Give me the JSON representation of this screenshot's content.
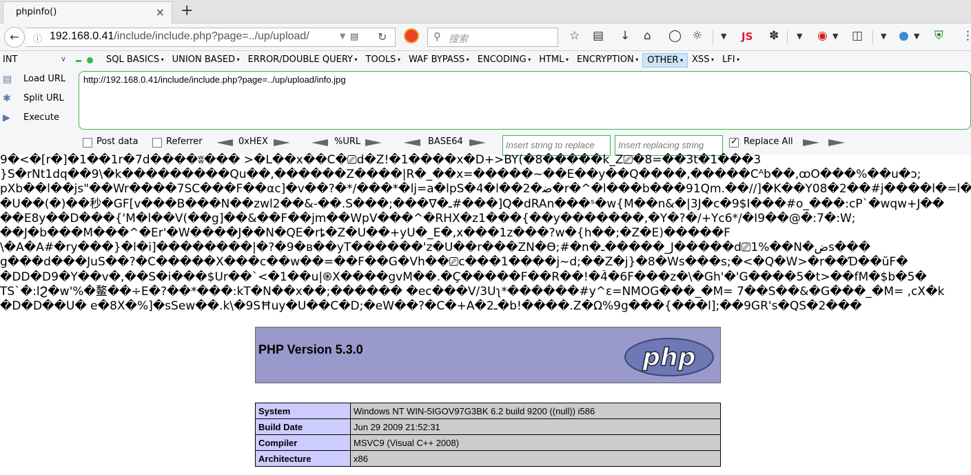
{
  "browser": {
    "tab_title": "phpinfo()",
    "tab_close": "×",
    "new_tab": "+",
    "url_host": "192.168.0.41",
    "url_path": "/include/include.php?page=../up/upload/",
    "search_placeholder": "搜索",
    "js_label": "JS"
  },
  "hackbar": {
    "select_value": "INT",
    "menus": [
      {
        "label": "SQL BASICS",
        "has_caret": true
      },
      {
        "label": "UNION BASED",
        "has_caret": true
      },
      {
        "label": "ERROR/DOUBLE QUERY",
        "has_caret": true
      },
      {
        "label": "TOOLS",
        "has_caret": true
      },
      {
        "label": "WAF BYPASS",
        "has_caret": true
      },
      {
        "label": "ENCODING",
        "has_caret": true
      },
      {
        "label": "HTML",
        "has_caret": true
      },
      {
        "label": "ENCRYPTION",
        "has_caret": true
      },
      {
        "label": "OTHER",
        "has_caret": true
      },
      {
        "label": "XSS",
        "has_caret": true
      },
      {
        "label": "LFI",
        "has_caret": true
      }
    ],
    "active_menu": "OTHER",
    "load_url": "Load URL",
    "split_url": "Split URL",
    "execute": "Execute",
    "url_value": "http://192.168.0.41/include/include.php?page=../up/upload/info.jpg",
    "post_data": "Post data",
    "referrer": "Referrer",
    "hex": "0xHEX",
    "urlenc": "%URL",
    "base64": "BASE64",
    "replace_placeholder": "Insert string to replace",
    "replacing_placeholder": "Insert replacing string",
    "replace_all": "Replace All",
    "replace_all_checked": true
  },
  "garbage_lines": [
    "9�<�[r�]�1��1r�7d����ʬ��� >�L��x��C�⎚d�Z!�1����x�D+>BY(�8�����k_Z⎚�8=��3t�1���3",
    "}S�rNt1dq��9\\�k���������Qu��,������Z����|R�_��x=�����~��E��y��Q����,�����Cᴬb��,ꝏO���%��u�ɔ;",
    "pXb��l��js\"��Wr����7SC���F��αc]�v��?�*/���*�lj=a�lpS�4�l��2�ﺿ�r�^�l���b���91Qm.��//]�K��Y08�2��#j����l�=l��",
    "�U��(�)��秒�GF[v���B���N��zwl2��&-��.S���;���∇�ـ#���]Q�dRAn���ˢ�w{M��n&�|3J�c�9$I���#o_���:cP`�wqw+J��",
    "��E8y��D���{'M�l��V(��g]��&��F��jm��WpV���^�RHX�z1���{��y�������,�Y�?�/+Yc6*/�I9��@�:7�:W;",
    "��J�b���M���^�Er'�W����J��N�QE�rȶ�Z�U��+yU�_E�,x���1z���?w�{h��;�Z�E)�����F",
    "\\�A�A#�ry���}�l�i]��������|�?�9�в��yT������'z�U��r���ZN�ϴ;#�n�ـ�����_J�����d⎚1%��N�ضs���",
    "g���d���JuS��?�C�����X���c��w��=��F��G�Vh��⎚c���1����j~d;��Z�j}�8�Ws���s;�<�Q�W>�r��Ɗ��ŭF�",
    "�DD�D9�Y��v�,��S�i���$Ur��`<�1��u|֍X����gvM��.�Ç�����F��R��!�4̆�6F���z�\\�Gh'�'G����5�t>��fM�$b�5�",
    "TS`�:lϨ�w'%�鳌��÷E�?��*���:kT�N��x��;������ �ec���V/3Uʅ*������#y^ɛ=NMOG���_�M= 7��S��&�G���_�M= ,cX�k",
    "�D�D��U� e�8X�%]�sSew��.k\\�9SĦuy�U��C�D;�eW��?�C�+A�2ـ�b!����.Z�Ω%9g���{���l];��9GR's�QS�2���"
  ],
  "php": {
    "version_title": "PHP Version 5.3.0",
    "logo_text": "php",
    "rows": [
      {
        "key": "System",
        "value": "Windows NT WIN-5IGOV97G3BK 6.2 build 9200 ((null)) i586"
      },
      {
        "key": "Build Date",
        "value": "Jun 29 2009 21:52:31"
      },
      {
        "key": "Compiler",
        "value": "MSVC9 (Visual C++ 2008)"
      },
      {
        "key": "Architecture",
        "value": "x86"
      }
    ]
  },
  "icons": [
    "back-arrow-icon",
    "info-icon",
    "page-icon",
    "reload-icon",
    "blocker-icon",
    "search-icon",
    "star-icon",
    "reading-list-icon",
    "download-icon",
    "home-icon",
    "addon-icons",
    "shield-icon",
    "menu-icon"
  ],
  "colors": {
    "green_border": "#3bb54a",
    "php_header_bg": "#9999cc",
    "php_key_bg": "#ccccff",
    "php_value_bg": "#cccccc",
    "active_menu_bg": "#cce4f7"
  }
}
